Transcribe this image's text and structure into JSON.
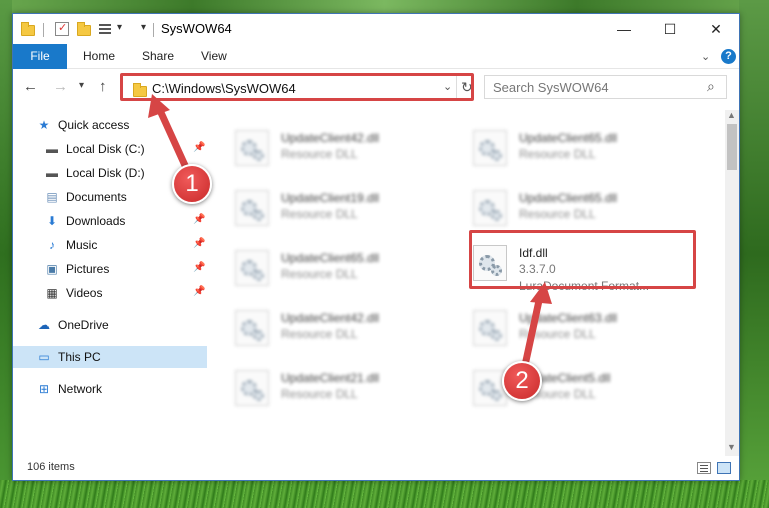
{
  "window": {
    "title": "SysWOW64",
    "minimize": "—",
    "maximize": "☐",
    "close": "✕"
  },
  "ribbon": {
    "tabs": [
      "File",
      "Home",
      "Share",
      "View"
    ],
    "help": "?"
  },
  "address": {
    "path": "C:\\Windows\\SysWOW64",
    "search_placeholder": "Search SysWOW64"
  },
  "nav_pane": {
    "items": [
      {
        "label": "Quick access",
        "icon": "star-icon"
      },
      {
        "label": "Local Disk (C:)",
        "icon": "drive-icon",
        "pinned": true
      },
      {
        "label": "Local Disk (D:)",
        "icon": "drive-icon"
      },
      {
        "label": "Documents",
        "icon": "documents-icon"
      },
      {
        "label": "Downloads",
        "icon": "download-icon",
        "pinned": true
      },
      {
        "label": "Music",
        "icon": "music-icon",
        "pinned": true
      },
      {
        "label": "Pictures",
        "icon": "pictures-icon",
        "pinned": true
      },
      {
        "label": "Videos",
        "icon": "videos-icon",
        "pinned": true
      },
      {
        "label": "OneDrive",
        "icon": "cloud-icon"
      },
      {
        "label": "This PC",
        "icon": "computer-icon",
        "selected": true
      },
      {
        "label": "Network",
        "icon": "network-icon"
      }
    ]
  },
  "files": [
    {
      "name": "UpdateClient42.dll",
      "sub": "Resource DLL"
    },
    {
      "name": "UpdateClient65.dll",
      "sub": "Resource DLL"
    },
    {
      "name": "UpdateClient19.dll",
      "sub": "Resource DLL"
    },
    {
      "name": "UpdateClient65.dll",
      "sub": "Resource DLL"
    },
    {
      "name": "UpdateClient65.dll",
      "sub": "Resource DLL"
    },
    {
      "name": "Idf.dll",
      "sub": "3.3.7.0",
      "sub2": "LuraDocument Format...",
      "highlighted": true
    },
    {
      "name": "UpdateClient42.dll",
      "sub": "Resource DLL"
    },
    {
      "name": "UpdateClient63.dll",
      "sub": "Resource DLL"
    },
    {
      "name": "UpdateClient21.dll",
      "sub": "Resource DLL"
    },
    {
      "name": "UpdateClient5.dll",
      "sub": "Resource DLL"
    }
  ],
  "status": {
    "item_count": "106 items"
  },
  "annotations": {
    "step1": "1",
    "step2": "2",
    "color": "#d64545"
  }
}
